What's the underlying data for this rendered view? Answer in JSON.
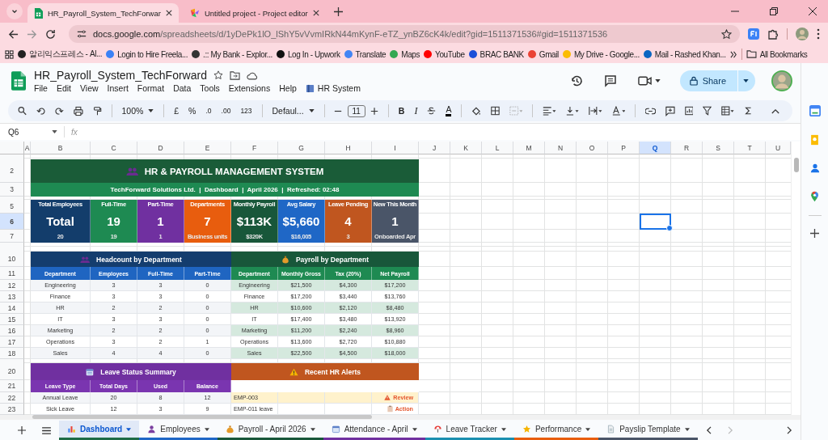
{
  "browser": {
    "tabs": [
      {
        "title": "HR_Payroll_System_TechForwar",
        "selected": true
      },
      {
        "title": "Untitled project - Project editor",
        "selected": false
      }
    ],
    "url_host": "docs.google.com",
    "url_path": "/spreadsheets/d/1yDePk1lO_lShY5vVvmIRkN44mKynF-eTZ_ynBZ6cK4k/edit?gid=1511371536#gid=1511371536",
    "bookmarks": [
      {
        "label": "알리익스프레스 - Al...",
        "color": "#222222"
      },
      {
        "label": "Login to Hire Freela...",
        "color": "#3b82f6"
      },
      {
        "label": ".:: My Bank - Explor...",
        "color": "#333333"
      },
      {
        "label": "Log In - Upwork",
        "color": "#111111"
      },
      {
        "label": "Translate",
        "color": "#4285f4"
      },
      {
        "label": "Maps",
        "color": "#34a853"
      },
      {
        "label": "YouTube",
        "color": "#ff0000"
      },
      {
        "label": "BRAC BANK",
        "color": "#1d4ed8"
      },
      {
        "label": "Gmail",
        "color": "#ea4335"
      },
      {
        "label": "My Drive - Google...",
        "color": "#fbbc04"
      },
      {
        "label": "Mail - Rashed Khan...",
        "color": "#0a66c2"
      }
    ],
    "all_bookmarks": "All Bookmarks"
  },
  "doc": {
    "title": "HR_Payroll_System_TechForward",
    "menus": [
      "File",
      "Edit",
      "View",
      "Insert",
      "Format",
      "Data",
      "Tools",
      "Extensions",
      "Help"
    ],
    "addon": "HR System",
    "share": "Share"
  },
  "toolbar": {
    "zoom": "100%",
    "currency": "£",
    "percent": "%",
    "decrease_decimal": ".0",
    "increase_decimal": ".00",
    "number_format": "123",
    "font": "Defaul...",
    "font_size": "11",
    "bold": "B",
    "italic": "I",
    "text_color": "A"
  },
  "name_box": "Q6",
  "fx": "fx",
  "columns": [
    {
      "label": "A",
      "selected": false
    },
    {
      "label": "B",
      "selected": false
    },
    {
      "label": "C",
      "selected": false
    },
    {
      "label": "D",
      "selected": false
    },
    {
      "label": "E",
      "selected": false
    },
    {
      "label": "F",
      "selected": false
    },
    {
      "label": "G",
      "selected": false
    },
    {
      "label": "H",
      "selected": false
    },
    {
      "label": "I",
      "selected": false
    },
    {
      "label": "J",
      "selected": false
    },
    {
      "label": "K",
      "selected": false
    },
    {
      "label": "L",
      "selected": false
    },
    {
      "label": "M",
      "selected": false
    },
    {
      "label": "N",
      "selected": false
    },
    {
      "label": "O",
      "selected": false
    },
    {
      "label": "P",
      "selected": false
    },
    {
      "label": "Q",
      "selected": true
    },
    {
      "label": "R",
      "selected": false
    },
    {
      "label": "S",
      "selected": false
    },
    {
      "label": "T",
      "selected": false
    },
    {
      "label": "U",
      "selected": false
    }
  ],
  "rows": [
    {
      "label": "2",
      "selected": false
    },
    {
      "label": "3",
      "selected": false
    },
    {
      "label": "5",
      "selected": false
    },
    {
      "label": "6",
      "selected": true
    },
    {
      "label": "7",
      "selected": false
    },
    {
      "label": "10",
      "selected": false
    },
    {
      "label": "11",
      "selected": false
    },
    {
      "label": "12",
      "selected": false
    },
    {
      "label": "13",
      "selected": false
    },
    {
      "label": "14",
      "selected": false
    },
    {
      "label": "15",
      "selected": false
    },
    {
      "label": "16",
      "selected": false
    },
    {
      "label": "17",
      "selected": false
    },
    {
      "label": "18",
      "selected": false
    },
    {
      "label": "20",
      "selected": false
    },
    {
      "label": "21",
      "selected": false
    },
    {
      "label": "22",
      "selected": false
    },
    {
      "label": "23",
      "selected": false
    }
  ],
  "dashboard": {
    "title": "HR & PAYROLL MANAGEMENT SYSTEM",
    "subtitle": "TechForward Solutions Ltd.  |  Dashboard  |  April 2026  |  Refreshed: 02:48",
    "kpis": [
      {
        "label": "Total Employees",
        "value": "Total",
        "sub": "20",
        "color": "#133d6b"
      },
      {
        "label": "Full-Time",
        "value": "19",
        "sub": "19",
        "color": "#1e8a52"
      },
      {
        "label": "Part-Time",
        "value": "1",
        "sub": "1",
        "color": "#7030a0"
      },
      {
        "label": "Departments",
        "value": "7",
        "sub": "Business units",
        "color": "#e85d0e"
      },
      {
        "label": "Monthly Payroll",
        "value": "$113K",
        "sub": "$320K",
        "color": "#18573a"
      },
      {
        "label": "Avg Salary",
        "value": "$5,660",
        "sub": "$16,005",
        "color": "#1f67c6"
      },
      {
        "label": "Leave Pending",
        "value": "4",
        "sub": "3",
        "color": "#c0561f"
      },
      {
        "label": "New This Month",
        "value": "1",
        "sub": "Onboarded Apr",
        "color": "#4a5568"
      }
    ],
    "headcount": {
      "title": "Headcount by Department",
      "columns": [
        "Department",
        "Employees",
        "Full-Time",
        "Part-Time"
      ],
      "rows": [
        [
          "Engineering",
          "3",
          "3",
          "0"
        ],
        [
          "Finance",
          "3",
          "3",
          "0"
        ],
        [
          "HR",
          "2",
          "2",
          "0"
        ],
        [
          "IT",
          "3",
          "3",
          "0"
        ],
        [
          "Marketing",
          "2",
          "2",
          "0"
        ],
        [
          "Operations",
          "3",
          "2",
          "1"
        ],
        [
          "Sales",
          "4",
          "4",
          "0"
        ]
      ]
    },
    "payroll": {
      "title": "Payroll by Department",
      "columns": [
        "Department",
        "Monthly Gross",
        "Tax (20%)",
        "Net Payroll"
      ],
      "rows": [
        [
          "Engineering",
          "$21,500",
          "$4,300",
          "$17,200"
        ],
        [
          "Finance",
          "$17,200",
          "$3,440",
          "$13,760"
        ],
        [
          "HR",
          "$10,600",
          "$2,120",
          "$8,480"
        ],
        [
          "IT",
          "$17,400",
          "$3,480",
          "$13,920"
        ],
        [
          "Marketing",
          "$11,200",
          "$2,240",
          "$8,960"
        ],
        [
          "Operations",
          "$13,600",
          "$2,720",
          "$10,880"
        ],
        [
          "Sales",
          "$22,500",
          "$4,500",
          "$18,000"
        ]
      ]
    },
    "leave": {
      "title": "Leave Status Summary",
      "columns": [
        "Leave Type",
        "Total Days",
        "Used",
        "Balance"
      ],
      "rows": [
        [
          "Annual Leave",
          "20",
          "8",
          "12"
        ],
        [
          "Sick Leave",
          "12",
          "3",
          "9"
        ]
      ]
    },
    "alerts": {
      "title": "Recent HR Alerts",
      "rows": [
        {
          "text": "EMP-003",
          "action": "Review",
          "kind": "review"
        },
        {
          "text": "EMP-011 leave",
          "action": "Action",
          "kind": "action"
        }
      ]
    }
  },
  "sheet_tabs": [
    {
      "label": "Dashboard",
      "selected": true,
      "color": "#1e6b46"
    },
    {
      "label": "Employees",
      "selected": false,
      "color": "#1f67c6"
    },
    {
      "label": "Payroll - April 2026",
      "selected": false,
      "color": "#18573a"
    },
    {
      "label": "Attendance - April",
      "selected": false,
      "color": "#7030a0"
    },
    {
      "label": "Leave Tracker",
      "selected": false,
      "color": "#1a8fb0"
    },
    {
      "label": "Performance",
      "selected": false,
      "color": "#e85d0e"
    },
    {
      "label": "Payslip Template",
      "selected": false,
      "color": "#4a5568"
    }
  ]
}
